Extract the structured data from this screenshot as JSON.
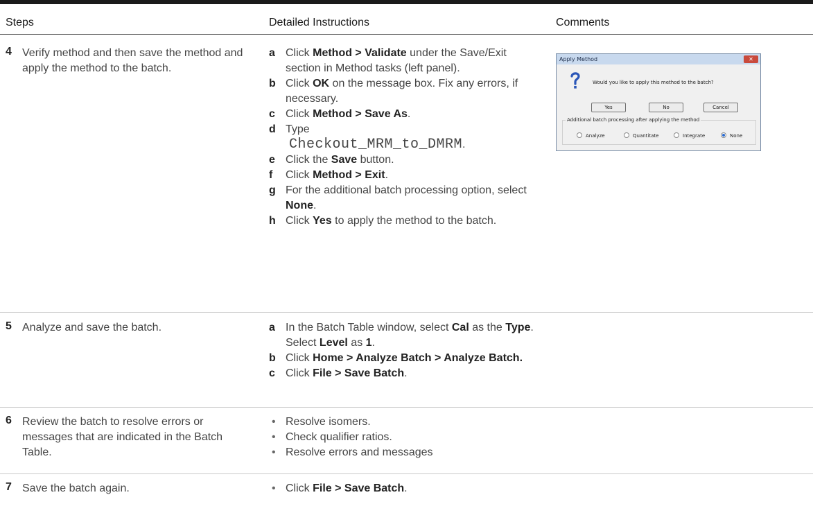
{
  "headers": {
    "steps": "Steps",
    "detailed": "Detailed Instructions",
    "comments": "Comments"
  },
  "rows": [
    {
      "num": "4",
      "text": "Verify method and then save the method and apply the method to the batch.",
      "items": [
        {
          "marker": "a",
          "pre": "Click ",
          "bold": "Method > Validate",
          "post": " under the Save/Exit section in Method tasks (left panel)."
        },
        {
          "marker": "b",
          "pre": "Click ",
          "bold": "OK",
          "post": " on the message box. Fix any errors, if necessary."
        },
        {
          "marker": "c",
          "pre": "Click ",
          "bold": "Method > Save As",
          "post": "."
        },
        {
          "marker": "d",
          "pre": "Type",
          "code": "Checkout_MRM_to_DMRM",
          "post": "."
        },
        {
          "marker": "e",
          "pre": "Click the ",
          "bold": "Save",
          "post": " button."
        },
        {
          "marker": "f",
          "pre": "Click ",
          "bold": "Method > Exit",
          "post": "."
        },
        {
          "marker": "g",
          "pre": "For the additional batch processing option, select ",
          "bold": "None",
          "post": "."
        },
        {
          "marker": "h",
          "pre": "Click ",
          "bold": "Yes",
          "post": " to apply the method to the batch."
        }
      ]
    },
    {
      "num": "5",
      "text": "Analyze and save the batch.",
      "items": [
        {
          "marker": "a",
          "pre": "In the Batch Table window, select ",
          "bold": "Cal",
          "mid": " as the ",
          "bold2": "Type",
          "mid2": ". Select ",
          "bold3": "Level",
          "mid3": " as ",
          "bold4": "1",
          "post": "."
        },
        {
          "marker": "b",
          "pre": "Click ",
          "bold": "Home > Analyze Batch > Analyze Batch.",
          "post": ""
        },
        {
          "marker": "c",
          "pre": "Click ",
          "bold": "File > Save Batch",
          "post": "."
        }
      ]
    },
    {
      "num": "6",
      "text": "Review the batch to resolve errors or messages that are indicated in the Batch Table.",
      "bullets": [
        "Resolve isomers.",
        "Check qualifier ratios.",
        "Resolve errors and messages"
      ]
    },
    {
      "num": "7",
      "text": "Save the batch again.",
      "bullet": {
        "pre": "Click ",
        "bold": "File > Save Batch",
        "post": "."
      }
    }
  ],
  "dialog": {
    "title": "Apply Method",
    "close_icon": "close-x-icon",
    "message": "Would you like to apply this method to the batch?",
    "buttons": [
      "Yes",
      "No",
      "Cancel"
    ],
    "group_label": "Additional batch processing after applying the method",
    "options": [
      "Analyze",
      "Quantitate",
      "Integrate",
      "None"
    ],
    "selected": "None"
  }
}
